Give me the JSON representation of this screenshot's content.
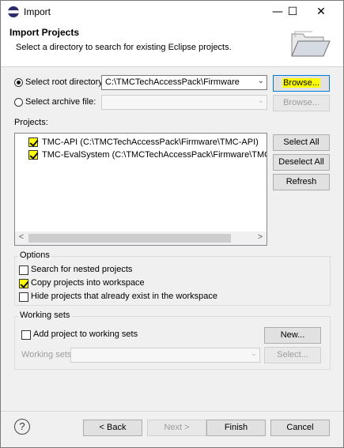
{
  "window": {
    "title": "Import",
    "controls": {
      "minimize": "—",
      "maximize": "☐",
      "close": "✕"
    }
  },
  "header": {
    "title": "Import Projects",
    "description": "Select a directory to search for existing Eclipse projects.",
    "image": "open-folder-icon"
  },
  "source": {
    "root_radio_label": "Select root directory:",
    "root_value": "C:\\TMCTechAccessPack\\Firmware",
    "browse_root_label": "Browse...",
    "archive_radio_label": "Select archive file:",
    "archive_value": "",
    "browse_archive_label": "Browse...",
    "selected": "root"
  },
  "projects": {
    "label": "Projects:",
    "items": [
      {
        "label": "TMC-API (C:\\TMCTechAccessPack\\Firmware\\TMC-API)",
        "checked": true
      },
      {
        "label": "TMC-EvalSystem (C:\\TMCTechAccessPack\\Firmware\\TMC-EvalSystem)",
        "checked": true
      }
    ],
    "select_all_label": "Select All",
    "deselect_all_label": "Deselect All",
    "refresh_label": "Refresh",
    "scroll_left": "<",
    "scroll_right": ">"
  },
  "options": {
    "legend": "Options",
    "search_nested_label": "Search for nested projects",
    "search_nested_checked": false,
    "copy_projects_label": "Copy projects into workspace",
    "copy_projects_checked": true,
    "hide_existing_label": "Hide projects that already exist in the workspace",
    "hide_existing_checked": false
  },
  "working_sets": {
    "legend": "Working sets",
    "add_label": "Add project to working sets",
    "add_checked": false,
    "new_label": "New...",
    "sets_label": "Working sets:",
    "sets_value": "",
    "select_label": "Select..."
  },
  "footer": {
    "help": "?",
    "back_label": "< Back",
    "next_label": "Next >",
    "finish_label": "Finish",
    "cancel_label": "Cancel"
  },
  "colors": {
    "highlight": "#ffff00",
    "focus_border": "#0078d7",
    "dialog_bg": "#f0f0f0"
  }
}
